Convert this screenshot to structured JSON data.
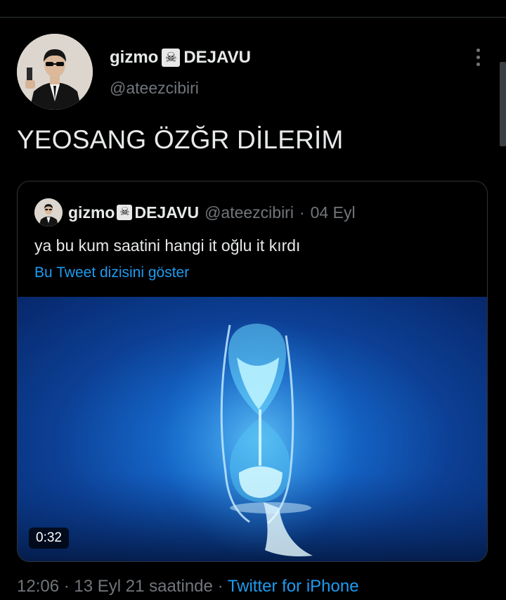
{
  "author": {
    "display_name": "gizmo",
    "name_suffix": "DEJAVU",
    "emoji": "☠",
    "handle": "@ateezcibiri"
  },
  "tweet": {
    "text": "YEOSANG ÖZĞR DİLERİM"
  },
  "quoted_tweet": {
    "display_name": "gizmo",
    "name_suffix": "DEJAVU",
    "emoji": "☠",
    "handle": "@ateezcibiri",
    "separator": "·",
    "date": "04 Eyl",
    "text": "ya bu kum saatini hangi it oğlu it kırdı",
    "show_thread": "Bu Tweet dizisini göster",
    "video_duration": "0:32"
  },
  "footer": {
    "time": "12:06",
    "sep1": "·",
    "date": "13 Eyl 21 saatinde",
    "sep2": "·",
    "source": "Twitter for iPhone"
  },
  "icons": {
    "more": "more-vertical-icon"
  },
  "colors": {
    "background": "#000000",
    "text_primary": "#e7e9ea",
    "text_secondary": "#71767b",
    "link": "#1d9bf0",
    "divider": "#2f3336"
  }
}
